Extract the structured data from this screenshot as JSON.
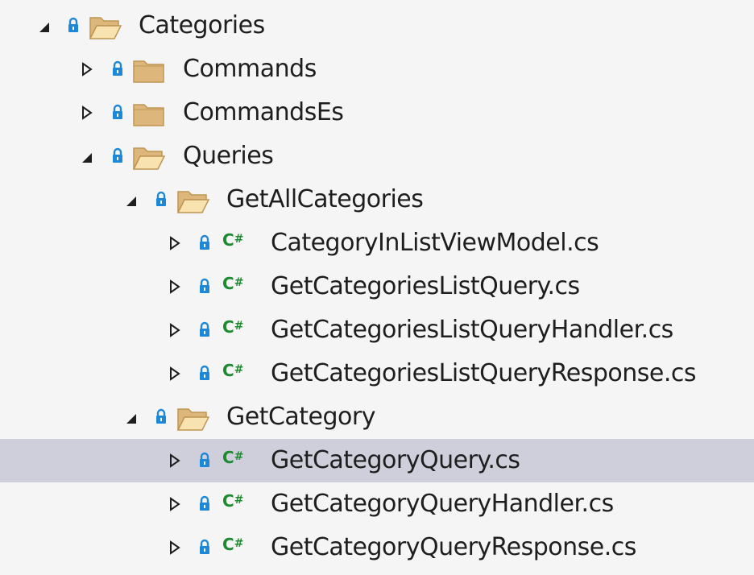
{
  "colors": {
    "background": "#f5f5f5",
    "selection": "#cfcfdc",
    "folder_fill": "#dcb67a",
    "folder_stroke": "#c09552",
    "lock_blue": "#1e88d8",
    "csharp_green": "#1d8a2f",
    "text": "#1e1e1e"
  },
  "tree": {
    "items": [
      {
        "label": "Categories",
        "icon": "folder-open-icon",
        "expander": "expanded-arrow-icon",
        "selected": false
      },
      {
        "label": "Commands",
        "icon": "folder-closed-icon",
        "expander": "collapsed-arrow-icon",
        "selected": false
      },
      {
        "label": "CommandsEs",
        "icon": "folder-closed-icon",
        "expander": "collapsed-arrow-icon",
        "selected": false
      },
      {
        "label": "Queries",
        "icon": "folder-open-icon",
        "expander": "expanded-arrow-icon",
        "selected": false
      },
      {
        "label": "GetAllCategories",
        "icon": "folder-open-icon",
        "expander": "expanded-arrow-icon",
        "selected": false
      },
      {
        "label": "CategoryInListViewModel.cs",
        "icon": "csharp-file-icon",
        "icon_text": "C#",
        "expander": "collapsed-arrow-icon",
        "selected": false
      },
      {
        "label": "GetCategoriesListQuery.cs",
        "icon": "csharp-file-icon",
        "icon_text": "C#",
        "expander": "collapsed-arrow-icon",
        "selected": false
      },
      {
        "label": "GetCategoriesListQueryHandler.cs",
        "icon": "csharp-file-icon",
        "icon_text": "C#",
        "expander": "collapsed-arrow-icon",
        "selected": false
      },
      {
        "label": "GetCategoriesListQueryResponse.cs",
        "icon": "csharp-file-icon",
        "icon_text": "C#",
        "expander": "collapsed-arrow-icon",
        "selected": false
      },
      {
        "label": "GetCategory",
        "icon": "folder-open-icon",
        "expander": "expanded-arrow-icon",
        "selected": false
      },
      {
        "label": "GetCategoryQuery.cs",
        "icon": "csharp-file-icon",
        "icon_text": "C#",
        "expander": "collapsed-arrow-icon",
        "selected": true
      },
      {
        "label": "GetCategoryQueryHandler.cs",
        "icon": "csharp-file-icon",
        "icon_text": "C#",
        "expander": "collapsed-arrow-icon",
        "selected": false
      },
      {
        "label": "GetCategoryQueryResponse.cs",
        "icon": "csharp-file-icon",
        "icon_text": "C#",
        "expander": "collapsed-arrow-icon",
        "selected": false
      }
    ]
  }
}
